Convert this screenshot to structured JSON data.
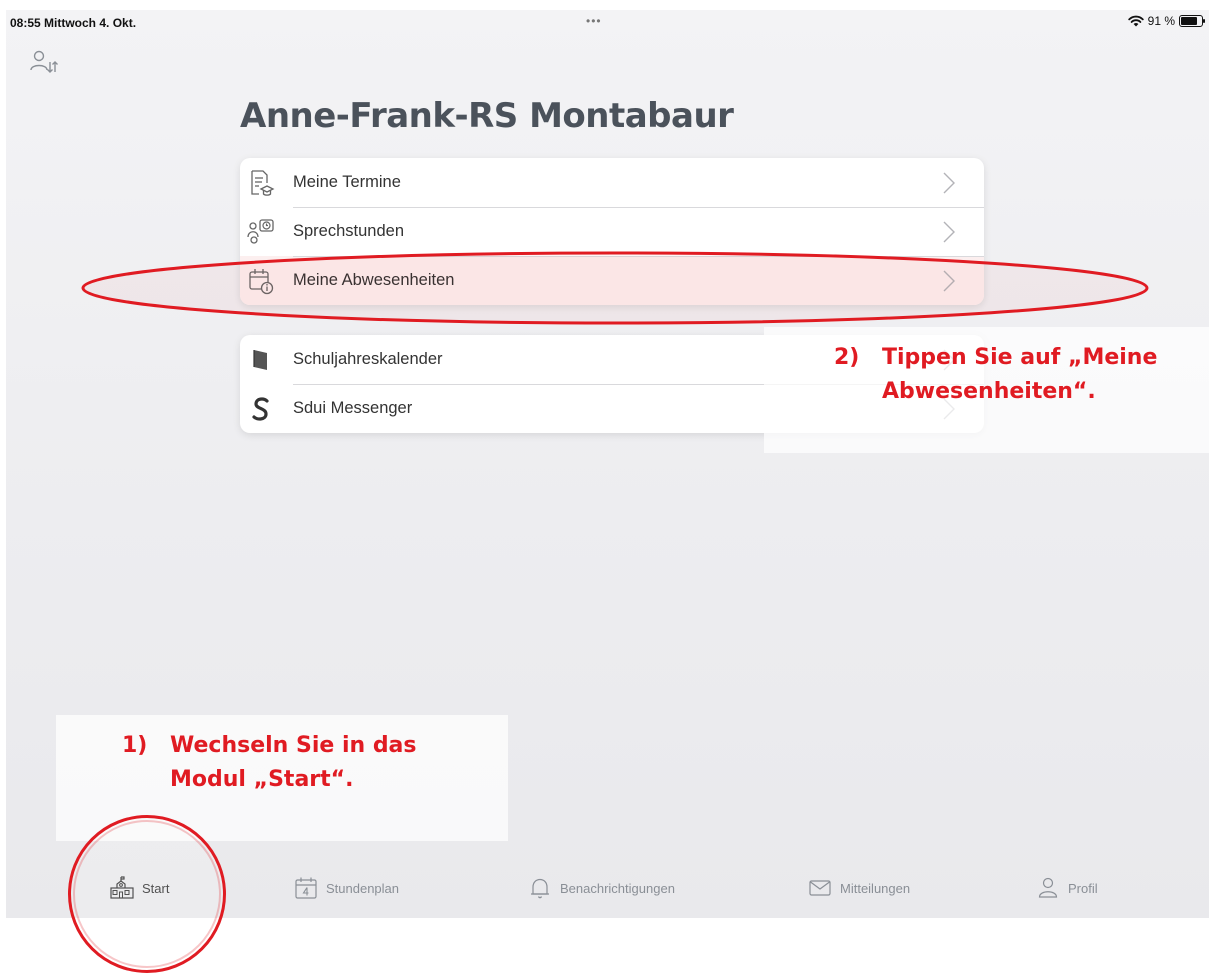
{
  "status_bar": {
    "time_date": "08:55  Mittwoch 4. Okt.",
    "dots": "•••",
    "battery": "91 %",
    "battery_level": 0.91
  },
  "header": {
    "title": "Anne-Frank-RS Montabaur"
  },
  "menu_group_1": [
    {
      "label": "Meine Termine",
      "icon": "calendar-document-icon"
    },
    {
      "label": "Sprechstunden",
      "icon": "consultation-clock-icon"
    },
    {
      "label": "Meine Abwesenheiten",
      "icon": "calendar-info-icon"
    }
  ],
  "menu_group_2": [
    {
      "label": "Schuljahreskalender",
      "icon": "book-icon"
    },
    {
      "label": "Sdui Messenger",
      "icon": "sdui-s-logo-icon"
    }
  ],
  "annotations": {
    "step1_num": "1)",
    "step1_line1": "Wechseln Sie in das",
    "step1_line2": "Modul „Start“.",
    "step2_num": "2)",
    "step2_line1": "Tippen Sie auf „Meine",
    "step2_line2": "Abwesenheiten“.",
    "color": "#e01b22"
  },
  "tab_bar": [
    {
      "label": "Start",
      "icon": "school-building-icon",
      "active": true
    },
    {
      "label": "Stundenplan",
      "icon": "calendar-4-icon",
      "active": false
    },
    {
      "label": "Benachrichtigungen",
      "icon": "bell-icon",
      "active": false
    },
    {
      "label": "Mitteilungen",
      "icon": "envelope-icon",
      "active": false
    },
    {
      "label": "Profil",
      "icon": "person-icon",
      "active": false
    }
  ]
}
